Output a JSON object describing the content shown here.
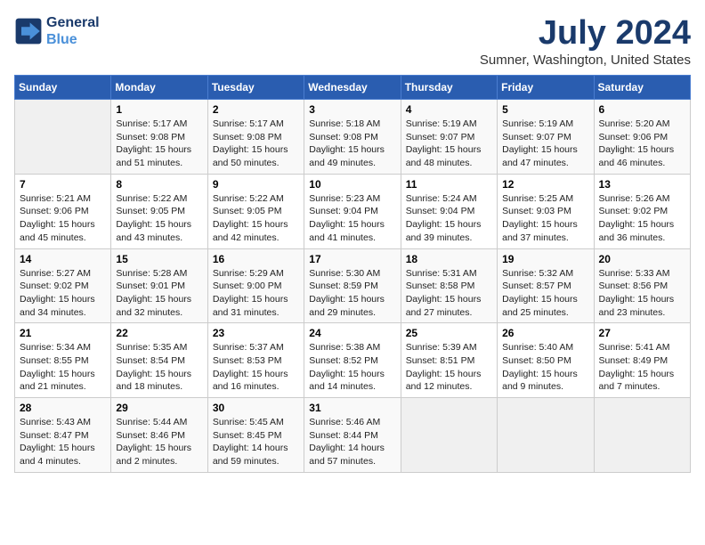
{
  "header": {
    "logo_line1": "General",
    "logo_line2": "Blue",
    "title": "July 2024",
    "location": "Sumner, Washington, United States"
  },
  "columns": [
    "Sunday",
    "Monday",
    "Tuesday",
    "Wednesday",
    "Thursday",
    "Friday",
    "Saturday"
  ],
  "weeks": [
    [
      {
        "day": "",
        "info": ""
      },
      {
        "day": "1",
        "info": "Sunrise: 5:17 AM\nSunset: 9:08 PM\nDaylight: 15 hours\nand 51 minutes."
      },
      {
        "day": "2",
        "info": "Sunrise: 5:17 AM\nSunset: 9:08 PM\nDaylight: 15 hours\nand 50 minutes."
      },
      {
        "day": "3",
        "info": "Sunrise: 5:18 AM\nSunset: 9:08 PM\nDaylight: 15 hours\nand 49 minutes."
      },
      {
        "day": "4",
        "info": "Sunrise: 5:19 AM\nSunset: 9:07 PM\nDaylight: 15 hours\nand 48 minutes."
      },
      {
        "day": "5",
        "info": "Sunrise: 5:19 AM\nSunset: 9:07 PM\nDaylight: 15 hours\nand 47 minutes."
      },
      {
        "day": "6",
        "info": "Sunrise: 5:20 AM\nSunset: 9:06 PM\nDaylight: 15 hours\nand 46 minutes."
      }
    ],
    [
      {
        "day": "7",
        "info": "Sunrise: 5:21 AM\nSunset: 9:06 PM\nDaylight: 15 hours\nand 45 minutes."
      },
      {
        "day": "8",
        "info": "Sunrise: 5:22 AM\nSunset: 9:05 PM\nDaylight: 15 hours\nand 43 minutes."
      },
      {
        "day": "9",
        "info": "Sunrise: 5:22 AM\nSunset: 9:05 PM\nDaylight: 15 hours\nand 42 minutes."
      },
      {
        "day": "10",
        "info": "Sunrise: 5:23 AM\nSunset: 9:04 PM\nDaylight: 15 hours\nand 41 minutes."
      },
      {
        "day": "11",
        "info": "Sunrise: 5:24 AM\nSunset: 9:04 PM\nDaylight: 15 hours\nand 39 minutes."
      },
      {
        "day": "12",
        "info": "Sunrise: 5:25 AM\nSunset: 9:03 PM\nDaylight: 15 hours\nand 37 minutes."
      },
      {
        "day": "13",
        "info": "Sunrise: 5:26 AM\nSunset: 9:02 PM\nDaylight: 15 hours\nand 36 minutes."
      }
    ],
    [
      {
        "day": "14",
        "info": "Sunrise: 5:27 AM\nSunset: 9:02 PM\nDaylight: 15 hours\nand 34 minutes."
      },
      {
        "day": "15",
        "info": "Sunrise: 5:28 AM\nSunset: 9:01 PM\nDaylight: 15 hours\nand 32 minutes."
      },
      {
        "day": "16",
        "info": "Sunrise: 5:29 AM\nSunset: 9:00 PM\nDaylight: 15 hours\nand 31 minutes."
      },
      {
        "day": "17",
        "info": "Sunrise: 5:30 AM\nSunset: 8:59 PM\nDaylight: 15 hours\nand 29 minutes."
      },
      {
        "day": "18",
        "info": "Sunrise: 5:31 AM\nSunset: 8:58 PM\nDaylight: 15 hours\nand 27 minutes."
      },
      {
        "day": "19",
        "info": "Sunrise: 5:32 AM\nSunset: 8:57 PM\nDaylight: 15 hours\nand 25 minutes."
      },
      {
        "day": "20",
        "info": "Sunrise: 5:33 AM\nSunset: 8:56 PM\nDaylight: 15 hours\nand 23 minutes."
      }
    ],
    [
      {
        "day": "21",
        "info": "Sunrise: 5:34 AM\nSunset: 8:55 PM\nDaylight: 15 hours\nand 21 minutes."
      },
      {
        "day": "22",
        "info": "Sunrise: 5:35 AM\nSunset: 8:54 PM\nDaylight: 15 hours\nand 18 minutes."
      },
      {
        "day": "23",
        "info": "Sunrise: 5:37 AM\nSunset: 8:53 PM\nDaylight: 15 hours\nand 16 minutes."
      },
      {
        "day": "24",
        "info": "Sunrise: 5:38 AM\nSunset: 8:52 PM\nDaylight: 15 hours\nand 14 minutes."
      },
      {
        "day": "25",
        "info": "Sunrise: 5:39 AM\nSunset: 8:51 PM\nDaylight: 15 hours\nand 12 minutes."
      },
      {
        "day": "26",
        "info": "Sunrise: 5:40 AM\nSunset: 8:50 PM\nDaylight: 15 hours\nand 9 minutes."
      },
      {
        "day": "27",
        "info": "Sunrise: 5:41 AM\nSunset: 8:49 PM\nDaylight: 15 hours\nand 7 minutes."
      }
    ],
    [
      {
        "day": "28",
        "info": "Sunrise: 5:43 AM\nSunset: 8:47 PM\nDaylight: 15 hours\nand 4 minutes."
      },
      {
        "day": "29",
        "info": "Sunrise: 5:44 AM\nSunset: 8:46 PM\nDaylight: 15 hours\nand 2 minutes."
      },
      {
        "day": "30",
        "info": "Sunrise: 5:45 AM\nSunset: 8:45 PM\nDaylight: 14 hours\nand 59 minutes."
      },
      {
        "day": "31",
        "info": "Sunrise: 5:46 AM\nSunset: 8:44 PM\nDaylight: 14 hours\nand 57 minutes."
      },
      {
        "day": "",
        "info": ""
      },
      {
        "day": "",
        "info": ""
      },
      {
        "day": "",
        "info": ""
      }
    ]
  ]
}
